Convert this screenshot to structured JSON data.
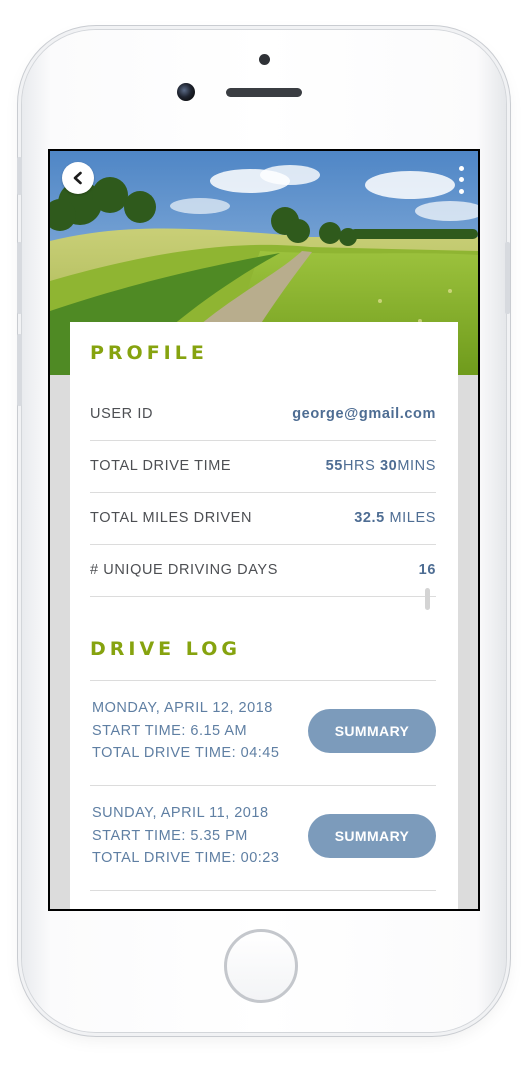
{
  "profile": {
    "title": "PROFILE",
    "user_id_label": "USER ID",
    "user_id_value": "george@gmail.com",
    "drive_time_label": "TOTAL DRIVE TIME",
    "drive_time_hours": "55",
    "drive_time_hours_unit": "HRS",
    "drive_time_mins": "30",
    "drive_time_mins_unit": "MINS",
    "miles_label": "TOTAL MILES DRIVEN",
    "miles_value": "32.5",
    "miles_unit": "MILES",
    "days_label": "# UNIQUE DRIVING DAYS",
    "days_value": "16"
  },
  "drive_log": {
    "title": "DRIVE LOG",
    "entries": [
      {
        "date": "MONDAY, APRIL 12, 2018",
        "start": "START TIME: 6.15 AM",
        "total": "TOTAL DRIVE TIME: 04:45",
        "button": "SUMMARY"
      },
      {
        "date": "SUNDAY, APRIL 11, 2018",
        "start": "START TIME: 5.35 PM",
        "total": "TOTAL DRIVE TIME: 00:23",
        "button": "SUMMARY"
      }
    ]
  },
  "icons": {
    "back": "chevron-left-icon",
    "menu": "kebab-menu-icon"
  },
  "colors": {
    "accent_green": "#86a30f",
    "value_blue": "#4e6d93",
    "button_blue": "#7c9bbb"
  }
}
